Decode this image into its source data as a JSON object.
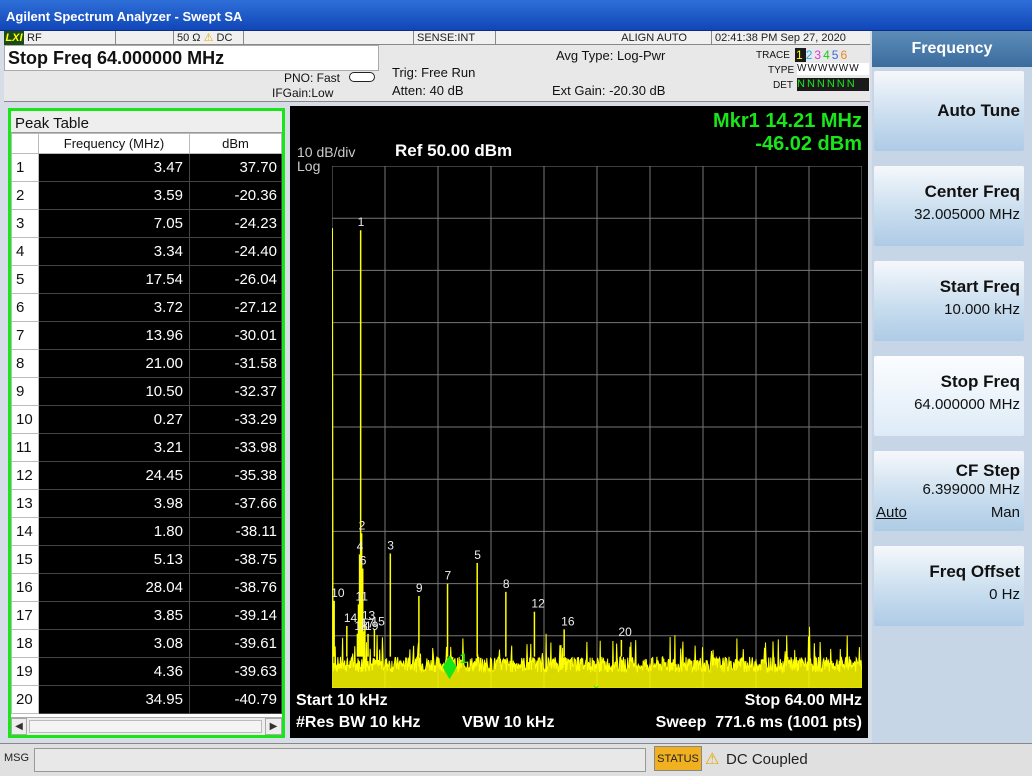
{
  "window": {
    "title": "Agilent Spectrum Analyzer - Swept SA"
  },
  "status_line": {
    "logo": "LXI",
    "rf": "RF",
    "impedance": "50 Ω",
    "warning": "⚠",
    "coupling": "DC",
    "sense": "SENSE:INT",
    "align": "ALIGN AUTO",
    "datetime": "02:41:38 PM Sep 27, 2020"
  },
  "info": {
    "stop_freq": "Stop Freq 64.000000 MHz",
    "pno": "PNO: Fast",
    "ifgain": "IFGain:Low",
    "trig": "Trig: Free Run",
    "atten": "Atten: 40 dB",
    "avg_type": "Avg Type: Log-Pwr",
    "ext_gain": "Ext Gain: -20.30 dB",
    "trace_label": "TRACE",
    "trace_nums": [
      "1",
      "2",
      "3",
      "4",
      "5",
      "6"
    ],
    "type_label": "TYPE",
    "type_vals": "WWWWWW",
    "det_label": "DET",
    "det_vals": "NNNNNN"
  },
  "peak_table": {
    "title": "Peak Table",
    "col_freq": "Frequency (MHz)",
    "col_dbm": "dBm",
    "rows": [
      {
        "n": "1",
        "f": "3.47",
        "d": "37.70"
      },
      {
        "n": "2",
        "f": "3.59",
        "d": "-20.36"
      },
      {
        "n": "3",
        "f": "7.05",
        "d": "-24.23"
      },
      {
        "n": "4",
        "f": "3.34",
        "d": "-24.40"
      },
      {
        "n": "5",
        "f": "17.54",
        "d": "-26.04"
      },
      {
        "n": "6",
        "f": "3.72",
        "d": "-27.12"
      },
      {
        "n": "7",
        "f": "13.96",
        "d": "-30.01"
      },
      {
        "n": "8",
        "f": "21.00",
        "d": "-31.58"
      },
      {
        "n": "9",
        "f": "10.50",
        "d": "-32.37"
      },
      {
        "n": "10",
        "f": "0.27",
        "d": "-33.29"
      },
      {
        "n": "11",
        "f": "3.21",
        "d": "-33.98"
      },
      {
        "n": "12",
        "f": "24.45",
        "d": "-35.38"
      },
      {
        "n": "13",
        "f": "3.98",
        "d": "-37.66"
      },
      {
        "n": "14",
        "f": "1.80",
        "d": "-38.11"
      },
      {
        "n": "15",
        "f": "5.13",
        "d": "-38.75"
      },
      {
        "n": "16",
        "f": "28.04",
        "d": "-38.76"
      },
      {
        "n": "17",
        "f": "3.85",
        "d": "-39.14"
      },
      {
        "n": "18",
        "f": "3.08",
        "d": "-39.61"
      },
      {
        "n": "19",
        "f": "4.36",
        "d": "-39.63"
      },
      {
        "n": "20",
        "f": "34.95",
        "d": "-40.79"
      }
    ]
  },
  "display": {
    "scale": "10 dB/div",
    "log": "Log",
    "ref": "Ref 50.00 dBm",
    "marker_freq": "Mkr1 14.21 MHz",
    "marker_amp": "-46.02 dBm",
    "start": "Start 10 kHz",
    "stop": "Stop 64.00 MHz",
    "rbw": "#Res BW 10 kHz",
    "vbw": "VBW 10 kHz",
    "sweep": "Sweep  771.6 ms (1001 pts)",
    "y_ticks": [
      "40.0",
      "30.0",
      "20.0",
      "10.0",
      "0.00",
      "-10.0",
      "-20.0",
      "-30.0",
      "-40.0"
    ],
    "marker_label": "1",
    "colors": {
      "trace": "#ffff00",
      "marker": "#19e619",
      "grid": "#777777"
    }
  },
  "chart_data": {
    "type": "line",
    "xlim": [
      0.01,
      64.0
    ],
    "ylim": [
      -50,
      50
    ],
    "x_unit": "MHz",
    "y_unit": "dBm",
    "grid": true,
    "peaks": [
      {
        "n": 1,
        "f": 3.47,
        "d": 37.7
      },
      {
        "n": 2,
        "f": 3.59,
        "d": -20.36
      },
      {
        "n": 3,
        "f": 7.05,
        "d": -24.23
      },
      {
        "n": 4,
        "f": 3.34,
        "d": -24.4
      },
      {
        "n": 5,
        "f": 17.54,
        "d": -26.04
      },
      {
        "n": 6,
        "f": 3.72,
        "d": -27.12
      },
      {
        "n": 7,
        "f": 13.96,
        "d": -30.01
      },
      {
        "n": 8,
        "f": 21.0,
        "d": -31.58
      },
      {
        "n": 9,
        "f": 10.5,
        "d": -32.37
      },
      {
        "n": 10,
        "f": 0.27,
        "d": -33.29
      },
      {
        "n": 11,
        "f": 3.21,
        "d": -33.98
      },
      {
        "n": 12,
        "f": 24.45,
        "d": -35.38
      },
      {
        "n": 13,
        "f": 3.98,
        "d": -37.66
      },
      {
        "n": 14,
        "f": 1.8,
        "d": -38.11
      },
      {
        "n": 15,
        "f": 5.13,
        "d": -38.75
      },
      {
        "n": 16,
        "f": 28.04,
        "d": -38.76
      },
      {
        "n": 17,
        "f": 3.85,
        "d": -39.14
      },
      {
        "n": 18,
        "f": 3.08,
        "d": -39.61
      },
      {
        "n": 19,
        "f": 4.36,
        "d": -39.63
      },
      {
        "n": 20,
        "f": 34.95,
        "d": -40.79
      }
    ],
    "marker": {
      "f": 14.21,
      "d": -46.02
    },
    "noise_floor": -46
  },
  "softkeys": {
    "header": "Frequency",
    "keys": [
      {
        "label": "Auto Tune",
        "value": ""
      },
      {
        "label": "Center Freq",
        "value": "32.005000 MHz"
      },
      {
        "label": "Start Freq",
        "value": "10.000 kHz"
      },
      {
        "label": "Stop Freq",
        "value": "64.000000 MHz"
      },
      {
        "label": "CF Step",
        "value": "6.399000 MHz",
        "opt_left": "Auto",
        "opt_right": "Man"
      },
      {
        "label": "Freq Offset",
        "value": "0 Hz"
      }
    ]
  },
  "msgbar": {
    "msg": "MSG",
    "status": "STATUS",
    "warning": "⚠",
    "text": "DC Coupled"
  }
}
